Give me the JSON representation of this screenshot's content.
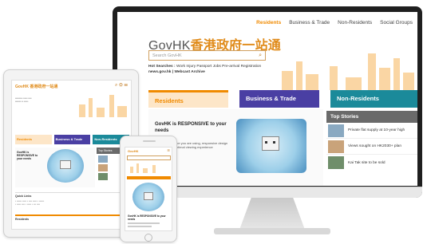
{
  "monitor": {
    "nav": [
      "Residents",
      "Business & Trade",
      "Non-Residents",
      "Social Groups"
    ],
    "logo_gov": "GovHK",
    "logo_cn": "香港政府一站通",
    "search_placeholder": "Search GovHK",
    "hot_searches_label": "Hot Searches :",
    "hot_searches": "Work Injury   Passport   Jobs   Pre-arrival Registration",
    "hot_searches_2": "news.gov.hk  |  Webcast Archive",
    "tabs": [
      "Residents",
      "Business & Trade",
      "Non-Residents"
    ],
    "hero_title": "GovHK is RESPONSIVE to your needs",
    "hero_sub": "Whichever device you are using, responsive design gives you the optimal viewing experience",
    "top_stories_title": "Top Stories",
    "stories": [
      "Private flat supply at 10-year high",
      "Views sought on HK2030+ plan",
      "Kai Tak site to be sold"
    ]
  },
  "tablet": {
    "logo": "GovHK 香港政府一站通",
    "tabs": [
      "Residents",
      "Business & Trade",
      "Non-Residents"
    ],
    "hero_title": "GovHK is RESPONSIVE to your needs",
    "top_stories_title": "Top Stories",
    "quick_links_title": "Quick Links",
    "residents_title": "Residents"
  },
  "phone": {
    "logo": "GovHK",
    "hero_title": "GovHK is RESPONSIVE to your needs"
  },
  "colors": {
    "residents": "#f08a00",
    "business": "#4a3fa3",
    "nonresidents": "#1b8a9a",
    "orange_logo": "#e08b1a"
  }
}
